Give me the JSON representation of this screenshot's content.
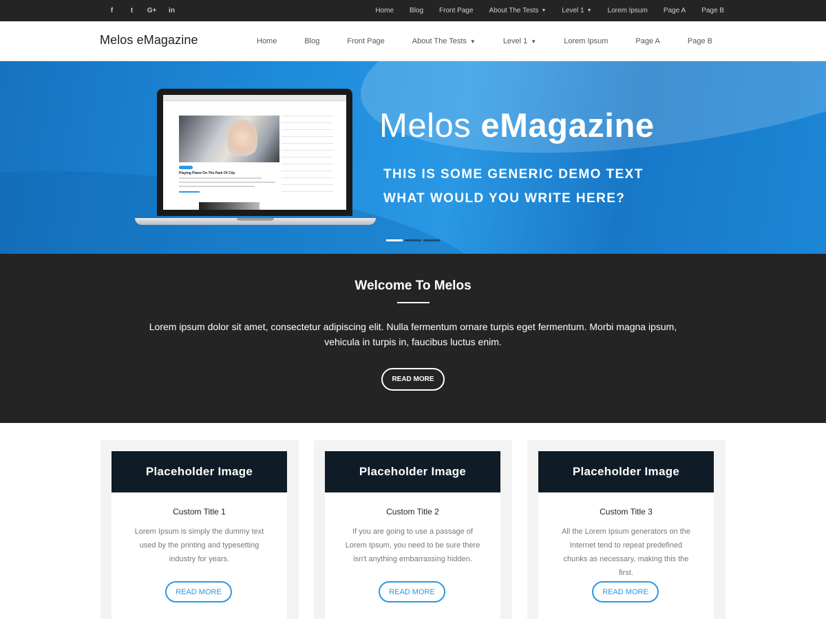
{
  "topbar": {
    "social": [
      {
        "icon": "facebook-icon",
        "glyph": "f"
      },
      {
        "icon": "twitter-icon",
        "glyph": "t"
      },
      {
        "icon": "google-plus-icon",
        "glyph": "G+"
      },
      {
        "icon": "linkedin-icon",
        "glyph": "in"
      }
    ],
    "nav": [
      "Home",
      "Blog",
      "Front Page",
      "About The Tests",
      "Level 1",
      "Lorem Ipsum",
      "Page A",
      "Page B"
    ]
  },
  "header": {
    "brand": "Melos eMagazine",
    "nav": [
      "Home",
      "Blog",
      "Front Page",
      "About The Tests",
      "Level 1",
      "Lorem Ipsum",
      "Page A",
      "Page B"
    ]
  },
  "hero": {
    "title_light": "Melos ",
    "title_bold": "eMagazine",
    "line1": "THIS IS SOME GENERIC DEMO TEXT",
    "line2": "WHAT WOULD YOU WRITE HERE?",
    "screen_post_title": "Playing Piano On The Park Of City",
    "slides": 3,
    "active_slide": 1
  },
  "welcome": {
    "heading": "Welcome To Melos",
    "text": "Lorem ipsum dolor sit amet, consectetur adipiscing elit. Nulla fermentum ornare turpis eget fermentum. Morbi magna ipsum, vehicula in turpis in, faucibus luctus enim.",
    "button": "READ MORE"
  },
  "cards": [
    {
      "placeholder": "Placeholder Image",
      "title": "Custom Title 1",
      "text": "Lorem Ipsum is simply the dummy text used by the printing and typesetting industry for years.",
      "button": "READ MORE"
    },
    {
      "placeholder": "Placeholder Image",
      "title": "Custom Title 2",
      "text": "If you are going to use a passage of Lorem Ipsum, you need to be sure there isn't anything embarrassing hidden.",
      "button": "READ MORE"
    },
    {
      "placeholder": "Placeholder Image",
      "title": "Custom Title 3",
      "text": "All the Lorem Ipsum generators on the Internet tend to repeat predefined chunks as necessary, making this the first.",
      "button": "READ MORE"
    }
  ],
  "colors": {
    "accent": "#2a98e4",
    "dark": "#242424",
    "placeholder_bg": "#0f1c27"
  }
}
